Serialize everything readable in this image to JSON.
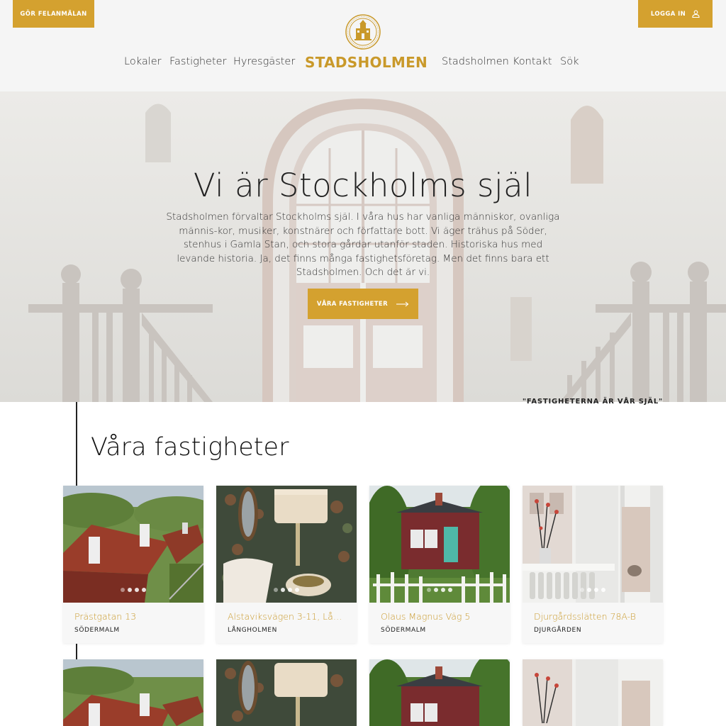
{
  "header": {
    "report_button": "GÖR FELANMÄLAN",
    "login_button": "LOGGA IN",
    "logo_text": "STADSHOLMEN",
    "nav_left": [
      "Lokaler",
      "Fastigheter",
      "Hyresgäster"
    ],
    "nav_right": [
      "Stadsholmen",
      "Kontakt",
      "Sök"
    ]
  },
  "hero": {
    "title": "Vi är Stockholms själ",
    "text": "Stadsholmen förvaltar Stockholms själ. I våra hus har vanliga människor, ovanliga männis-kor, musiker, konstnärer och författare bott. Vi äger trähus på Söder, stenhus i Gamla Stan, och stora gårdar utanför staden. Historiska hus med levande historia. Ja, det finns många fastighetsföretag. Men det finns bara ett Stadsholmen. Och det är vi.",
    "cta": "VÅRA FASTIGHETER",
    "quote": "\"FASTIGHETERNA ÄR VÅR SJÄL\""
  },
  "properties": {
    "title": "Våra fastigheter",
    "items": [
      {
        "name": "Prästgatan 13",
        "area": "SÖDERMALM"
      },
      {
        "name": "Alstaviksvägen 3-11, Lång...",
        "area": "LÅNGHOLMEN"
      },
      {
        "name": "Olaus Magnus Väg 5",
        "area": "SÖDERMALM"
      },
      {
        "name": "Djurgårdsslätten 78A-B",
        "area": "DJURGÅRDEN"
      }
    ]
  },
  "colors": {
    "accent": "#d4a12f",
    "logo": "#c9992a"
  }
}
